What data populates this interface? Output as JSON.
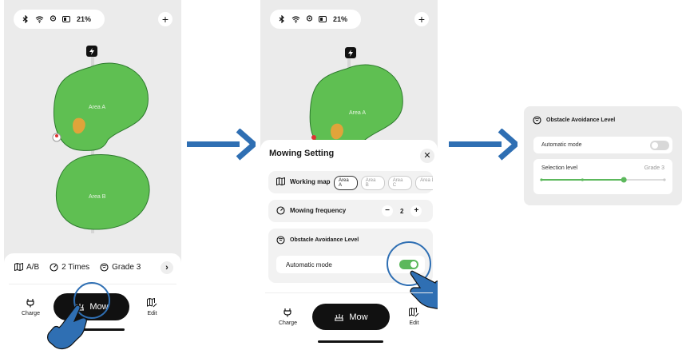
{
  "status": {
    "battery": "21%"
  },
  "map": {
    "area_a": "Area A",
    "area_b": "Area B"
  },
  "quickbar": {
    "map": "A/B",
    "frequency": "2 Times",
    "avoidance": "Grade 3"
  },
  "nav": {
    "charge": "Charge",
    "mow": "Mow",
    "edit": "Edit"
  },
  "mowing_setting": {
    "title": "Mowing Setting",
    "working_map_label": "Working map",
    "areas": [
      "Area A",
      "Area B",
      "Area C",
      "Area D"
    ],
    "selected_area": "Area A",
    "frequency_label": "Mowing frequency",
    "frequency_value": "2",
    "obstacle_label": "Obstacle Avoidance Level",
    "automatic_mode_label": "Automatic mode",
    "automatic_mode_on": true
  },
  "obstacle_panel": {
    "title": "Obstacle Avoidance Level",
    "automatic_mode_label": "Automatic mode",
    "automatic_mode_on": false,
    "selection_label": "Selection level",
    "selection_value": "Grade 3",
    "slider_level_fraction": 0.67
  },
  "colors": {
    "accent_green": "#5cb85c",
    "map_green": "#5fbf52",
    "flow_arrow": "#2f6fb3"
  }
}
